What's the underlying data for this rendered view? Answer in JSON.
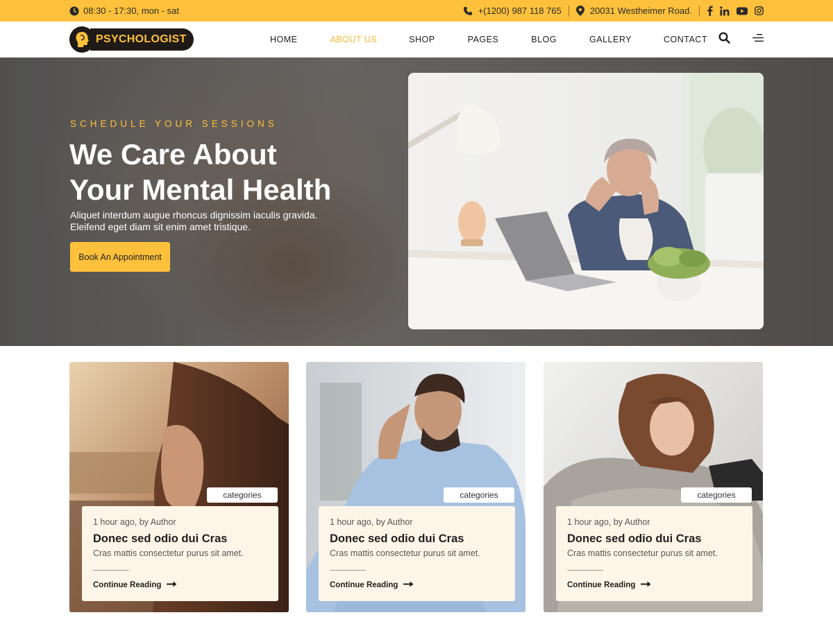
{
  "topbar": {
    "hours": "08:30 - 17:30, mon - sat",
    "phone": "+(1200) 987 118 765",
    "address": "20031 Westheimer Road."
  },
  "header": {
    "logo_text": "PSYCHOLOGIST",
    "nav": [
      {
        "label": "HOME"
      },
      {
        "label": "ABOUT US"
      },
      {
        "label": "SHOP"
      },
      {
        "label": "PAGES"
      },
      {
        "label": "BLOG"
      },
      {
        "label": "GALLERY"
      },
      {
        "label": "CONTACT"
      }
    ]
  },
  "hero": {
    "eyebrow": "SCHEDULE YOUR SESSIONS",
    "title_line1": "We Care About",
    "title_line2": "Your Mental Health",
    "text_line1": "Aliquet interdum augue rhoncus dignissim iaculis gravida.",
    "text_line2": "Eleifend eget diam sit enim amet tristique.",
    "cta_label": "Book An Appointment"
  },
  "cards": [
    {
      "category": "categories",
      "meta": "1 hour ago, by Author",
      "title": "Donec sed odio dui Cras",
      "excerpt": "Cras mattis consectetur purus sit amet.",
      "read_more": "Continue Reading"
    },
    {
      "category": "categories",
      "meta": "1 hour ago, by Author",
      "title": "Donec sed odio dui Cras",
      "excerpt": "Cras mattis consectetur purus sit amet.",
      "read_more": "Continue Reading"
    },
    {
      "category": "categories",
      "meta": "1 hour ago, by Author",
      "title": "Donec sed odio dui Cras",
      "excerpt": "Cras mattis consectetur purus sit amet.",
      "read_more": "Continue Reading"
    }
  ],
  "colors": {
    "accent": "#ffc13b",
    "accent_text": "#f5b82e",
    "dark": "#1f1a17",
    "card_body": "#fdf6e8"
  },
  "icons": {
    "hours": "clock-icon",
    "phone": "phone-icon",
    "address": "map-pin-icon",
    "social": [
      "facebook-icon",
      "linkedin-icon",
      "youtube-icon",
      "instagram-icon"
    ],
    "header": [
      "search-icon",
      "menu-icon"
    ],
    "card_link": "arrow-right-icon"
  }
}
